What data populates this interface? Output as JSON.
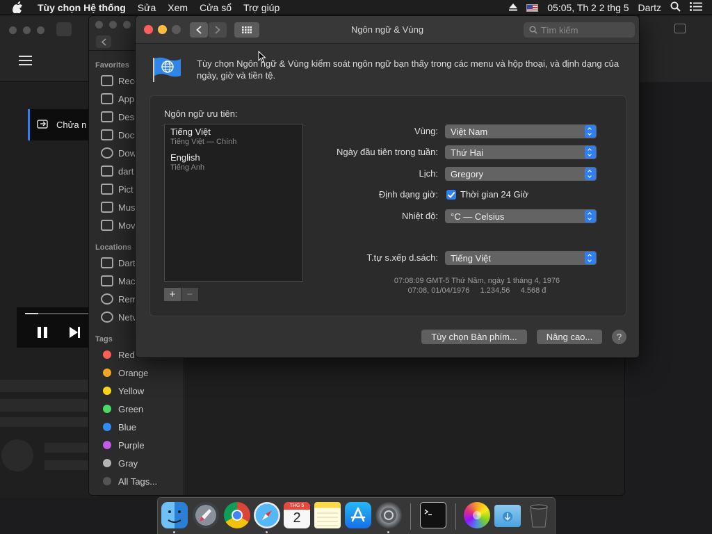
{
  "menubar": {
    "app_name": "Tùy chọn Hệ thống",
    "items": [
      "Sửa",
      "Xem",
      "Cửa sổ",
      "Trợ giúp"
    ],
    "clock": "05:05, Th 2 2 thg 5",
    "user": "Dartz"
  },
  "bg_app": {
    "banner_text": "Chửa n",
    "progress": 0.18
  },
  "finder": {
    "favorites_heading": "Favorites",
    "favorites": [
      "Rece",
      "App",
      "Des",
      "Doc",
      "Dow",
      "dart",
      "Pict",
      "Mus",
      "Mov"
    ],
    "locations_heading": "Locations",
    "locations": [
      "Dart",
      "Mac",
      "Rem",
      "Netv"
    ],
    "tags_heading": "Tags",
    "tags": [
      {
        "label": "Red",
        "color": "#ff5f57"
      },
      {
        "label": "Orange",
        "color": "#f5a623"
      },
      {
        "label": "Yellow",
        "color": "#f7d51d"
      },
      {
        "label": "Green",
        "color": "#4cd964"
      },
      {
        "label": "Blue",
        "color": "#2f8bf5"
      },
      {
        "label": "Purple",
        "color": "#c15ae8"
      },
      {
        "label": "Gray",
        "color": "#b4b4b4"
      },
      {
        "label": "All Tags...",
        "color": "#555555"
      }
    ]
  },
  "prefs": {
    "window_title": "Ngôn ngữ & Vùng",
    "search_placeholder": "Tìm kiếm",
    "intro": "Tùy chọn Ngôn ngữ & Vùng kiểm soát ngôn ngữ bạn thấy trong các menu và hộp thoại, và định dạng của ngày, giờ và tiền tệ.",
    "preferred_label": "Ngôn ngữ ưu tiên:",
    "languages": [
      {
        "name": "Tiếng Việt",
        "sub": "Tiếng Việt — Chính"
      },
      {
        "name": "English",
        "sub": "Tiếng Anh"
      }
    ],
    "add_symbol": "+",
    "remove_symbol": "−",
    "region_label": "Vùng:",
    "region_value": "Việt Nam",
    "first_day_label": "Ngày đầu tiên trong tuần:",
    "first_day_value": "Thứ Hai",
    "calendar_label": "Lịch:",
    "calendar_value": "Gregory",
    "time_format_label": "Định dạng giờ:",
    "time_format_checkbox": "Thời gian 24 Giờ",
    "time_format_checked": true,
    "temperature_label": "Nhiệt độ:",
    "temperature_value": "°C — Celsius",
    "sort_label": "T.tự s.xếp d.sách:",
    "sort_value": "Tiếng Việt",
    "sample_line1": "07:08:09 GMT-5 Thứ Năm, ngày 1 tháng 4, 1976",
    "sample_line2": "07:08, 01/04/1976     1.234,56     4.568 đ",
    "keyboard_button": "Tùy chọn Bàn phím...",
    "advanced_button": "Nâng cao...",
    "help_button": "?"
  },
  "dock": {
    "calendar_month": "THG 5",
    "calendar_day": "2",
    "apps": [
      "finder",
      "launchpad",
      "chrome",
      "safari",
      "calendar",
      "notes",
      "app-store",
      "system-preferences",
      "terminal",
      "photos",
      "downloads-folder",
      "trash"
    ]
  },
  "colors": {
    "accent": "#2f7ff2",
    "close": "#fc605c",
    "minimize": "#fdbc40"
  }
}
